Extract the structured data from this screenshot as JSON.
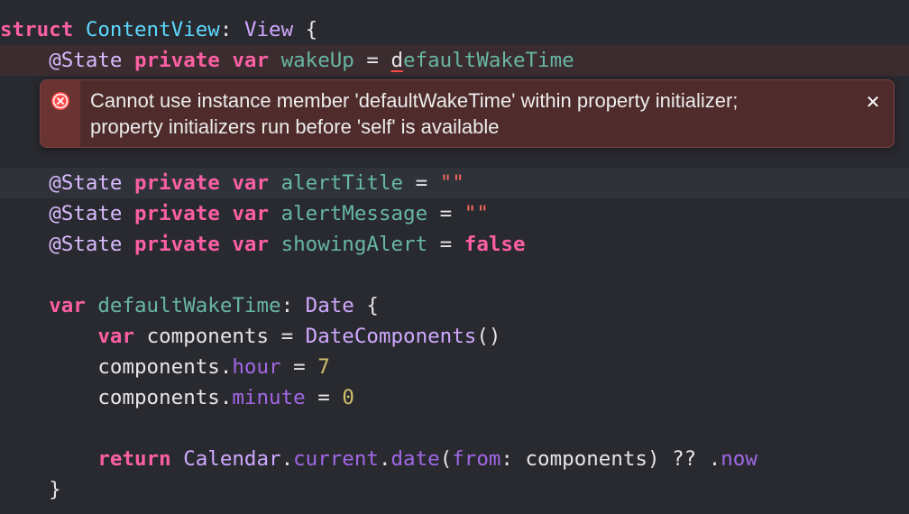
{
  "code": {
    "l1": {
      "kw_struct": "struct",
      "name": "ContentView",
      "colon": ":",
      "proto": "View",
      "brace": " {"
    },
    "l2": {
      "attr": "@State",
      "kw_private": "private",
      "kw_var": "var",
      "name": "wakeUp",
      "eq": " = ",
      "rhs_first": "d",
      "rhs_rest": "efaultWakeTime"
    },
    "l4": {
      "attr": "@State",
      "kw_private": "private",
      "kw_var": "var",
      "name": "alertTitle",
      "eq": " = ",
      "value": "\"\""
    },
    "l5": {
      "attr": "@State",
      "kw_private": "private",
      "kw_var": "var",
      "name": "alertMessage",
      "eq": " = ",
      "value": "\"\""
    },
    "l6": {
      "attr": "@State",
      "kw_private": "private",
      "kw_var": "var",
      "name": "showingAlert",
      "eq": " = ",
      "value": "false"
    },
    "l8": {
      "kw_var": "var",
      "name": "defaultWakeTime",
      "colon": ":",
      "type": "Date",
      "brace": " {"
    },
    "l9": {
      "kw_var": "var",
      "name": "components",
      "eq": " = ",
      "type": "DateComponents",
      "parens": "()"
    },
    "l10": {
      "obj": "components",
      "dot": ".",
      "prop": "hour",
      "eq": " = ",
      "value": "7"
    },
    "l11": {
      "obj": "components",
      "dot": ".",
      "prop": "minute",
      "eq": " = ",
      "value": "0"
    },
    "l13": {
      "kw_return": "return",
      "type": "Calendar",
      "dot1": ".",
      "prop1": "current",
      "dot2": ".",
      "method": "date",
      "paren_open": "(",
      "label": "from",
      "arg": ": components) ?? .",
      "now": "now"
    },
    "l14": {
      "brace": "}"
    }
  },
  "error": {
    "message_line1": "Cannot use instance member 'defaultWakeTime' within property initializer;",
    "message_line2": "property initializers run before 'self' is available",
    "close_glyph": "✕",
    "color": "#ff4a4a"
  }
}
